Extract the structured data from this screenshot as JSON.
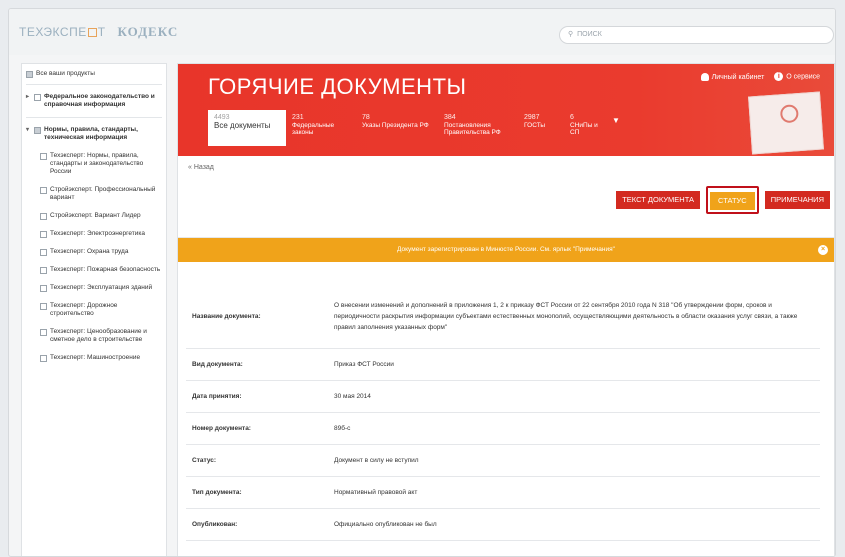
{
  "topbar": {
    "logo_left_a": "ТЕХЭКСПЕ",
    "logo_left_b": "Т",
    "logo_right": "КОДЕКС",
    "search_placeholder": "ПОИСК"
  },
  "sidebar": {
    "all_products": "Все ваши продукты",
    "groups": [
      {
        "label": "Федеральное законодательство и справочная информация",
        "bold": true
      },
      {
        "label": "Нормы, правила, стандарты, техническая информация",
        "bold": true
      }
    ],
    "items": [
      "Техэксперт: Нормы, правила, стандарты и законодательство России",
      "Стройэксперт. Профессиональный вариант",
      "Стройэксперт. Вариант Лидер",
      "Техэксперт: Электроэнергетика",
      "Техэксперт: Охрана труда",
      "Техэксперт: Пожарная безопасность",
      "Техэксперт: Эксплуатация зданий",
      "Техэксперт: Дорожное строительство",
      "Техэксперт: Ценообразование и сметное дело в строительстве",
      "Техэксперт: Машиностроение"
    ]
  },
  "header": {
    "title": "ГОРЯЧИЕ ДОКУМЕНТЫ",
    "cabinet": "Личный кабинет",
    "about": "О сервисе",
    "more": "▼"
  },
  "tabs": [
    {
      "count": "4493",
      "label": "Все документы"
    },
    {
      "count": "231",
      "label": "Федеральные законы"
    },
    {
      "count": "78",
      "label": "Указы Президента РФ"
    },
    {
      "count": "384",
      "label": "Постановления Правительства РФ"
    },
    {
      "count": "2987",
      "label": "ГОСТы"
    },
    {
      "count": "6",
      "label": "СНиПы и СП"
    }
  ],
  "toolbar": {
    "back": "« Назад",
    "text_btn": "ТЕКСТ ДОКУМЕНТА",
    "status_btn": "СТАТУС",
    "notes_btn": "ПРИМЕЧАНИЯ"
  },
  "notice": "Документ зарегистрирован в Минюсте России. См. ярлык \"Примечания\"",
  "details": [
    {
      "key": "Название документа:",
      "value": "О внесении изменений и дополнений в приложения 1, 2 к приказу ФСТ России от 22 сентября 2010 года N 318 \"Об утверждении форм, сроков и периодичности раскрытия информации субъектами естественных монополий, осуществляющими деятельность в области оказания услуг связи, а также правил заполнения указанных форм\""
    },
    {
      "key": "Вид документа:",
      "value": "Приказ ФСТ России"
    },
    {
      "key": "Дата принятия:",
      "value": "30 мая 2014"
    },
    {
      "key": "Номер документа:",
      "value": "89б-с"
    },
    {
      "key": "Статус:",
      "value": "Документ в силу не вступил"
    },
    {
      "key": "Тип документа:",
      "value": "Нормативный правовой акт"
    },
    {
      "key": "Опубликован:",
      "value": "Официально опубликован не был"
    }
  ],
  "colors": {
    "brand_red": "#e8352a",
    "status_orange": "#f0a31a",
    "highlight_border": "#c0101a"
  }
}
